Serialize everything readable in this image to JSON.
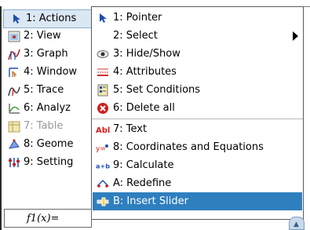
{
  "main_menu": {
    "items": [
      {
        "label": "1: Actions",
        "icon": "pointer-icon"
      },
      {
        "label": "2: View",
        "icon": "view-icon"
      },
      {
        "label": "3: Graph",
        "icon": "graph-icon"
      },
      {
        "label": "4: Window",
        "icon": "window-icon"
      },
      {
        "label": "5: Trace",
        "icon": "trace-icon"
      },
      {
        "label": "6: Analyz",
        "icon": "analyze-icon"
      },
      {
        "label": "7: Table",
        "icon": "table-icon"
      },
      {
        "label": "8: Geome",
        "icon": "geometry-icon"
      },
      {
        "label": "9: Setting",
        "icon": "settings-icon"
      }
    ]
  },
  "submenu": {
    "items": [
      {
        "label": "1: Pointer",
        "icon": "pointer-icon"
      },
      {
        "label": "2: Select",
        "icon": ""
      },
      {
        "label": "3: Hide/Show",
        "icon": "eye-icon"
      },
      {
        "label": "4: Attributes",
        "icon": "attributes-icon"
      },
      {
        "label": "5: Set Conditions",
        "icon": "conditions-icon"
      },
      {
        "label": "6: Delete all",
        "icon": "delete-icon"
      },
      {
        "label": "7: Text",
        "icon": "text-icon"
      },
      {
        "label": "8: Coordinates and Equations",
        "icon": "coordinates-icon"
      },
      {
        "label": "9: Calculate",
        "icon": "calculate-icon"
      },
      {
        "label": "A: Redefine",
        "icon": "redefine-icon"
      },
      {
        "label": "B: Insert Slider",
        "icon": "slider-icon"
      }
    ]
  },
  "function_entry": {
    "label": "f1(x)="
  },
  "colors": {
    "selection": "#2f7fbf",
    "active_item": "#dbe8f4"
  }
}
